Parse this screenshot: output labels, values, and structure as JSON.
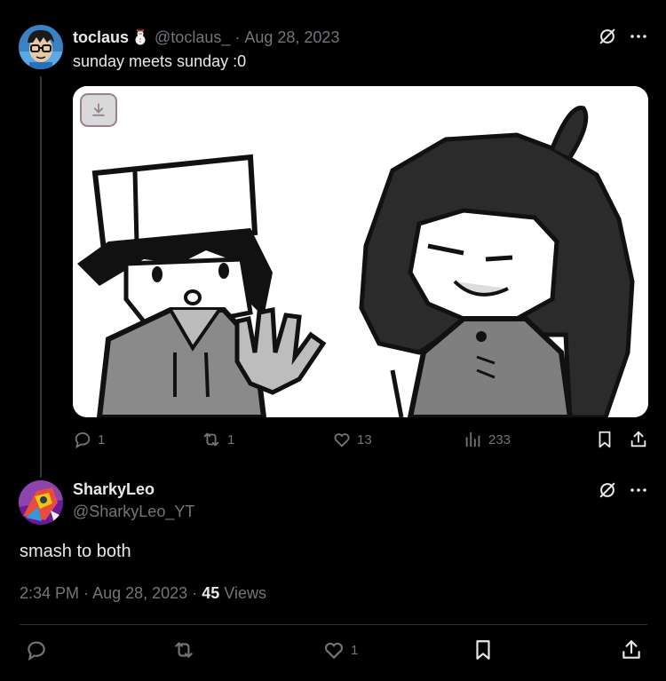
{
  "tweet1": {
    "display_name": "toclaus",
    "emoji": "snowman-icon",
    "handle": "@toclaus_",
    "separator": "·",
    "date": "Aug 28, 2023",
    "text": "sunday meets sunday :0",
    "media": {
      "has_download_button": true,
      "description_icon": "download-icon"
    },
    "stats": {
      "replies": "1",
      "reposts": "1",
      "likes": "13",
      "views": "233"
    }
  },
  "tweet2": {
    "display_name": "SharkyLeo",
    "handle": "@SharkyLeo_YT",
    "text": "smash to both",
    "time": "2:34 PM",
    "dot1": "·",
    "date": "Aug 28, 2023",
    "dot2": "·",
    "views_count": "45",
    "views_label": "Views",
    "stats": {
      "likes": "1"
    }
  },
  "colors": {
    "background": "#000000",
    "text": "#e7e9ea",
    "muted": "#71767b",
    "divider": "#2f3336"
  }
}
